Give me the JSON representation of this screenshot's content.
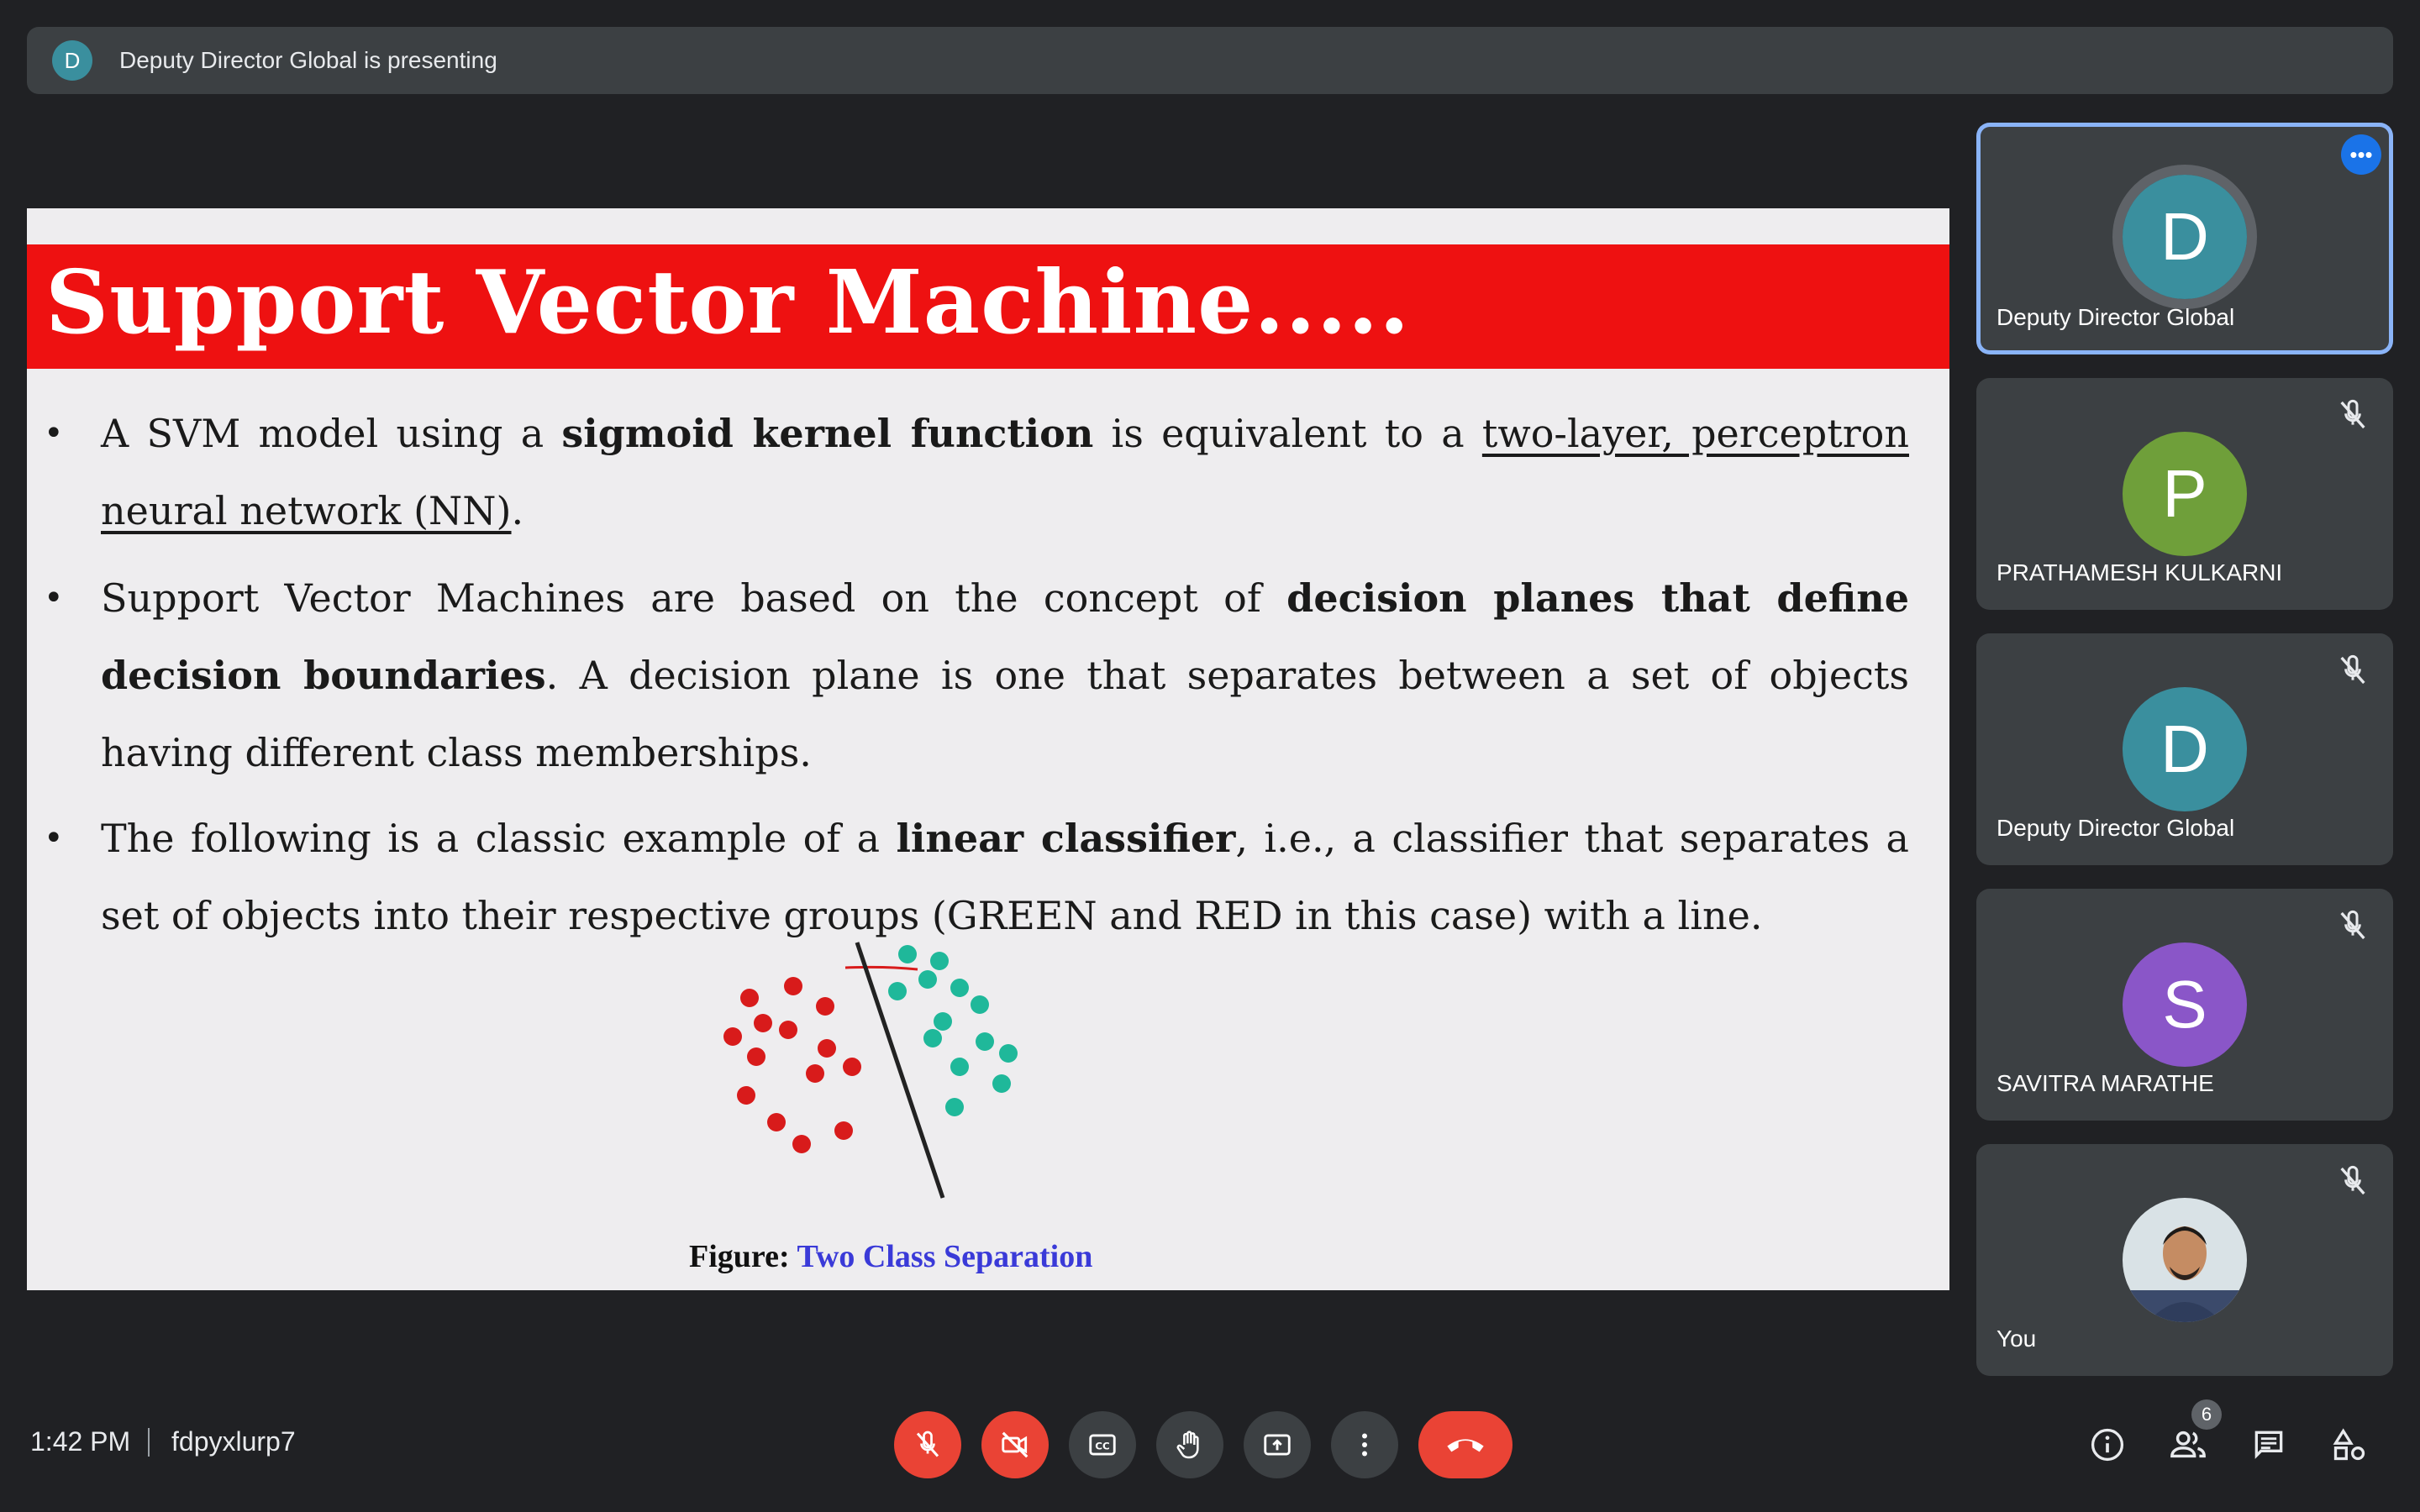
{
  "banner": {
    "avatar_letter": "D",
    "text": "Deputy Director Global is presenting"
  },
  "slide": {
    "title": "Support Vector Machine.....",
    "bullets": [
      {
        "parts": [
          "A SVM model using a ",
          "sigmoid kernel function",
          " is equivalent to a ",
          "two-layer, perceptron neural network (NN)",
          "."
        ]
      },
      {
        "parts": [
          "Support Vector Machines are based on the concept of ",
          "decision planes that define decision boundaries",
          ". A decision plane is one that separates between a set of objects having different class memberships."
        ]
      },
      {
        "parts": [
          "The following is a classic example of a ",
          "linear classifier",
          ", i.e., a classifier that separates a set of objects into their respective groups (GREEN and RED in this case) with a line."
        ]
      }
    ],
    "figure": {
      "caption_label": "Figure:",
      "caption_title": "Two Class Separation",
      "red_color": "#d81b1b",
      "green_color": "#1fb89a"
    }
  },
  "participants": [
    {
      "letter": "D",
      "name": "Deputy Director Global",
      "color": "#3a8f9e",
      "muted": false,
      "active": true
    },
    {
      "letter": "P",
      "name": "PRATHAMESH KULKARNI",
      "color": "#6f9f3a",
      "muted": true,
      "active": false
    },
    {
      "letter": "D",
      "name": "Deputy Director Global",
      "color": "#3a8f9e",
      "muted": true,
      "active": false
    },
    {
      "letter": "S",
      "name": "SAVITRA MARATHE",
      "color": "#8a56c8",
      "muted": true,
      "active": false
    },
    {
      "letter": "",
      "name": "You",
      "color": "#cfd8dc",
      "muted": true,
      "active": false
    }
  ],
  "bottom_bar": {
    "time": "1:42 PM",
    "meeting_code": "fdpyxlurp7",
    "people_count": "6",
    "controls": [
      "mic-off-icon",
      "camera-off-icon",
      "captions-icon",
      "raise-hand-icon",
      "present-icon",
      "more-options-icon",
      "end-call-icon"
    ],
    "right_icons": [
      "info-icon",
      "people-icon",
      "chat-icon",
      "activities-icon"
    ]
  }
}
